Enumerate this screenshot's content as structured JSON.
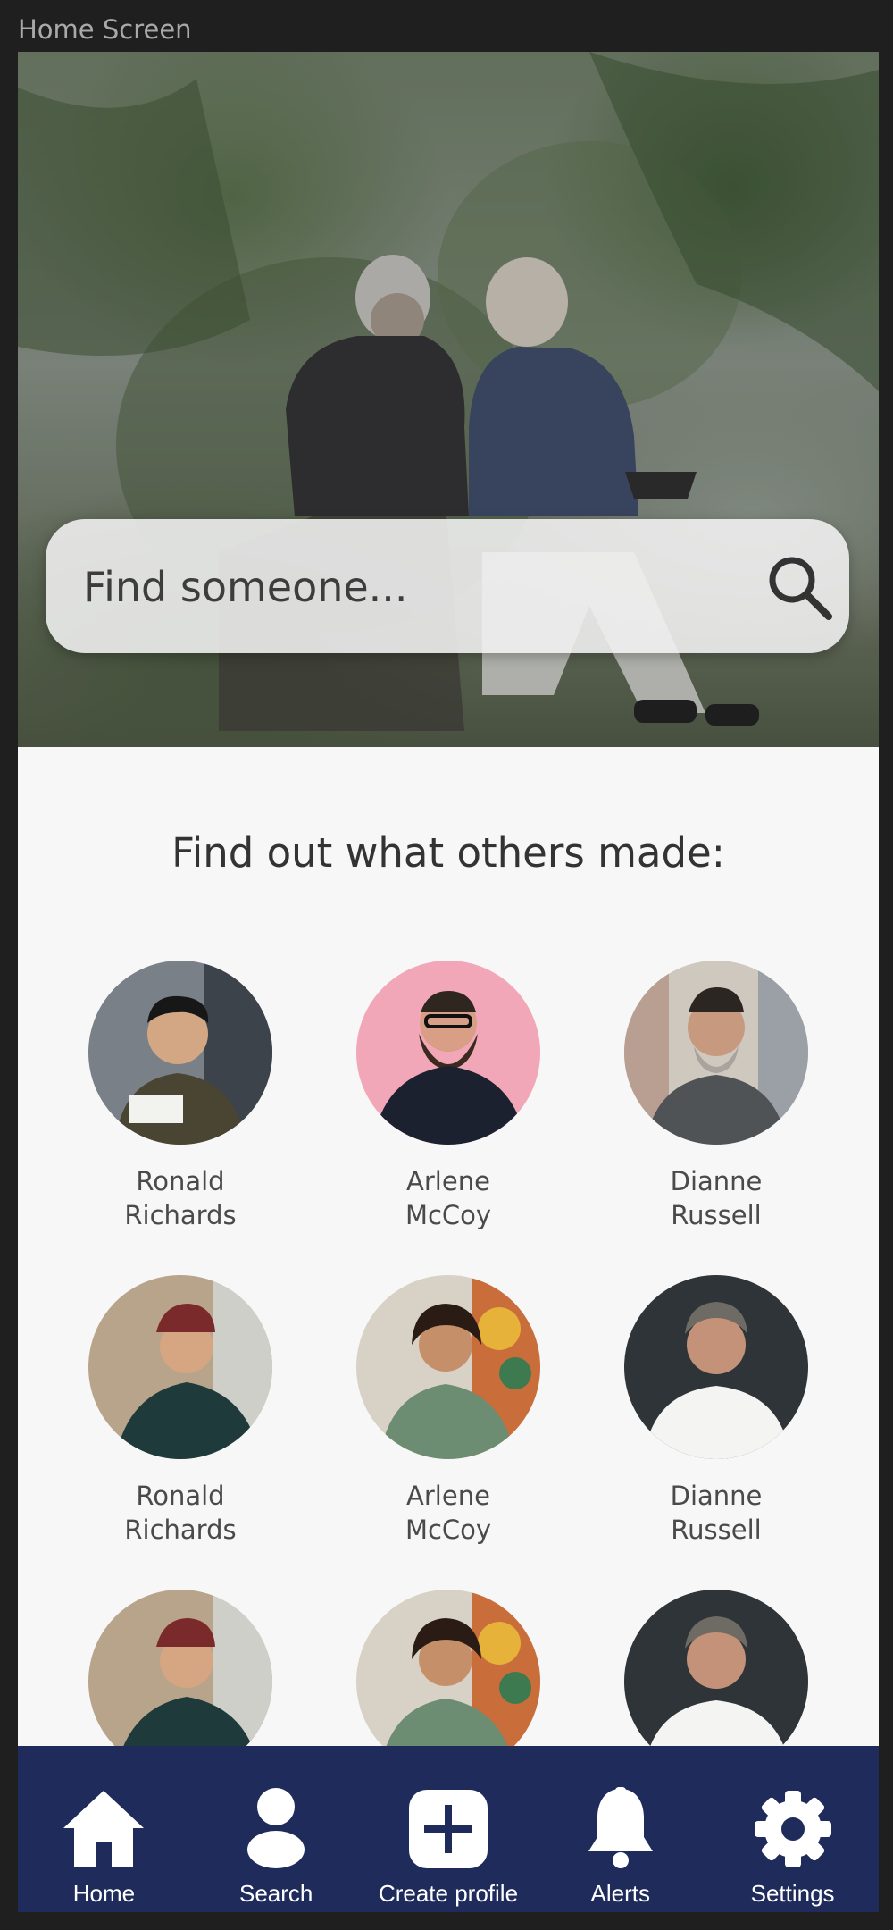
{
  "window": {
    "title": "Home Screen"
  },
  "search": {
    "placeholder": "Find someone..."
  },
  "section": {
    "title": "Find out what others made:"
  },
  "people": [
    {
      "name": "Ronald\nRichards"
    },
    {
      "name": "Arlene\nMcCoy"
    },
    {
      "name": "Dianne\nRussell"
    },
    {
      "name": "Ronald\nRichards"
    },
    {
      "name": "Arlene\nMcCoy"
    },
    {
      "name": "Dianne\nRussell"
    },
    {
      "name": ""
    },
    {
      "name": ""
    },
    {
      "name": ""
    }
  ],
  "tabs": [
    {
      "label": "Home",
      "icon": "home-icon"
    },
    {
      "label": "Search",
      "icon": "person-icon"
    },
    {
      "label": "Create profile",
      "icon": "plus-icon"
    },
    {
      "label": "Alerts",
      "icon": "bell-icon"
    },
    {
      "label": "Settings",
      "icon": "gear-icon"
    }
  ],
  "colors": {
    "tabbar": "#1e2b5b",
    "background": "#f7f7f7"
  }
}
